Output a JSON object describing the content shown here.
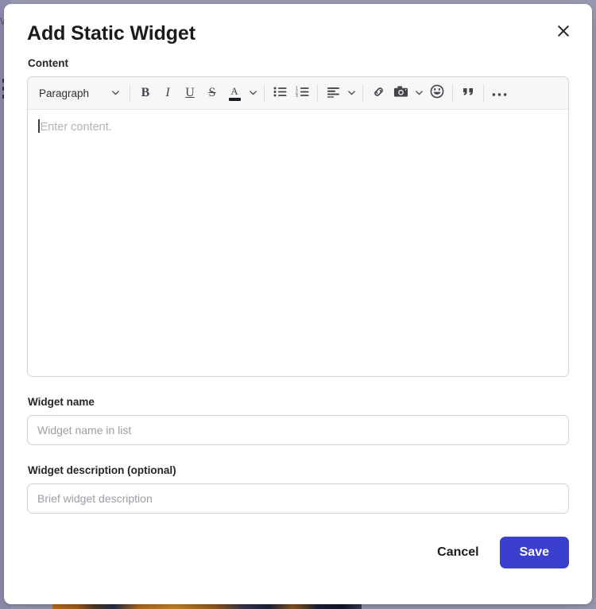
{
  "backdrop": {
    "edge_letter": "W",
    "drag_handle_icon": "drag-handle-icon"
  },
  "modal": {
    "title": "Add Static Widget",
    "close_icon": "close-icon",
    "content": {
      "label": "Content",
      "editor": {
        "placeholder": "Enter content.",
        "toolbar": {
          "block_style": {
            "value": "Paragraph",
            "chevron_icon": "chevron-down-icon"
          },
          "items": [
            {
              "name": "bold-button",
              "label": "B",
              "icon": "bold-icon"
            },
            {
              "name": "italic-button",
              "label": "I",
              "icon": "italic-icon"
            },
            {
              "name": "underline-button",
              "label": "U",
              "icon": "underline-icon"
            },
            {
              "name": "strikethrough-button",
              "label": "S",
              "icon": "strikethrough-icon"
            },
            {
              "name": "text-color-button",
              "label": "A",
              "icon": "text-color-icon"
            },
            {
              "name": "text-color-dropdown",
              "label": "",
              "icon": "chevron-down-icon"
            },
            {
              "name": "bullet-list-button",
              "label": "",
              "icon": "bullet-list-icon"
            },
            {
              "name": "numbered-list-button",
              "label": "",
              "icon": "numbered-list-icon"
            },
            {
              "name": "align-button",
              "label": "",
              "icon": "align-left-icon"
            },
            {
              "name": "align-dropdown",
              "label": "",
              "icon": "chevron-down-icon"
            },
            {
              "name": "link-button",
              "label": "",
              "icon": "link-icon"
            },
            {
              "name": "image-button",
              "label": "",
              "icon": "camera-icon"
            },
            {
              "name": "image-dropdown",
              "label": "",
              "icon": "chevron-down-icon"
            },
            {
              "name": "emoji-button",
              "label": "",
              "icon": "emoji-smile-icon"
            },
            {
              "name": "blockquote-button",
              "label": "”",
              "icon": "blockquote-icon"
            },
            {
              "name": "more-options-button",
              "label": "",
              "icon": "ellipsis-icon"
            }
          ]
        }
      }
    },
    "widget_name": {
      "label": "Widget name",
      "placeholder": "Widget name in list",
      "value": ""
    },
    "widget_description": {
      "label": "Widget description (optional)",
      "placeholder": "Brief widget description",
      "value": ""
    },
    "footer": {
      "cancel_label": "Cancel",
      "save_label": "Save",
      "save_color": "#3a3fce"
    }
  }
}
